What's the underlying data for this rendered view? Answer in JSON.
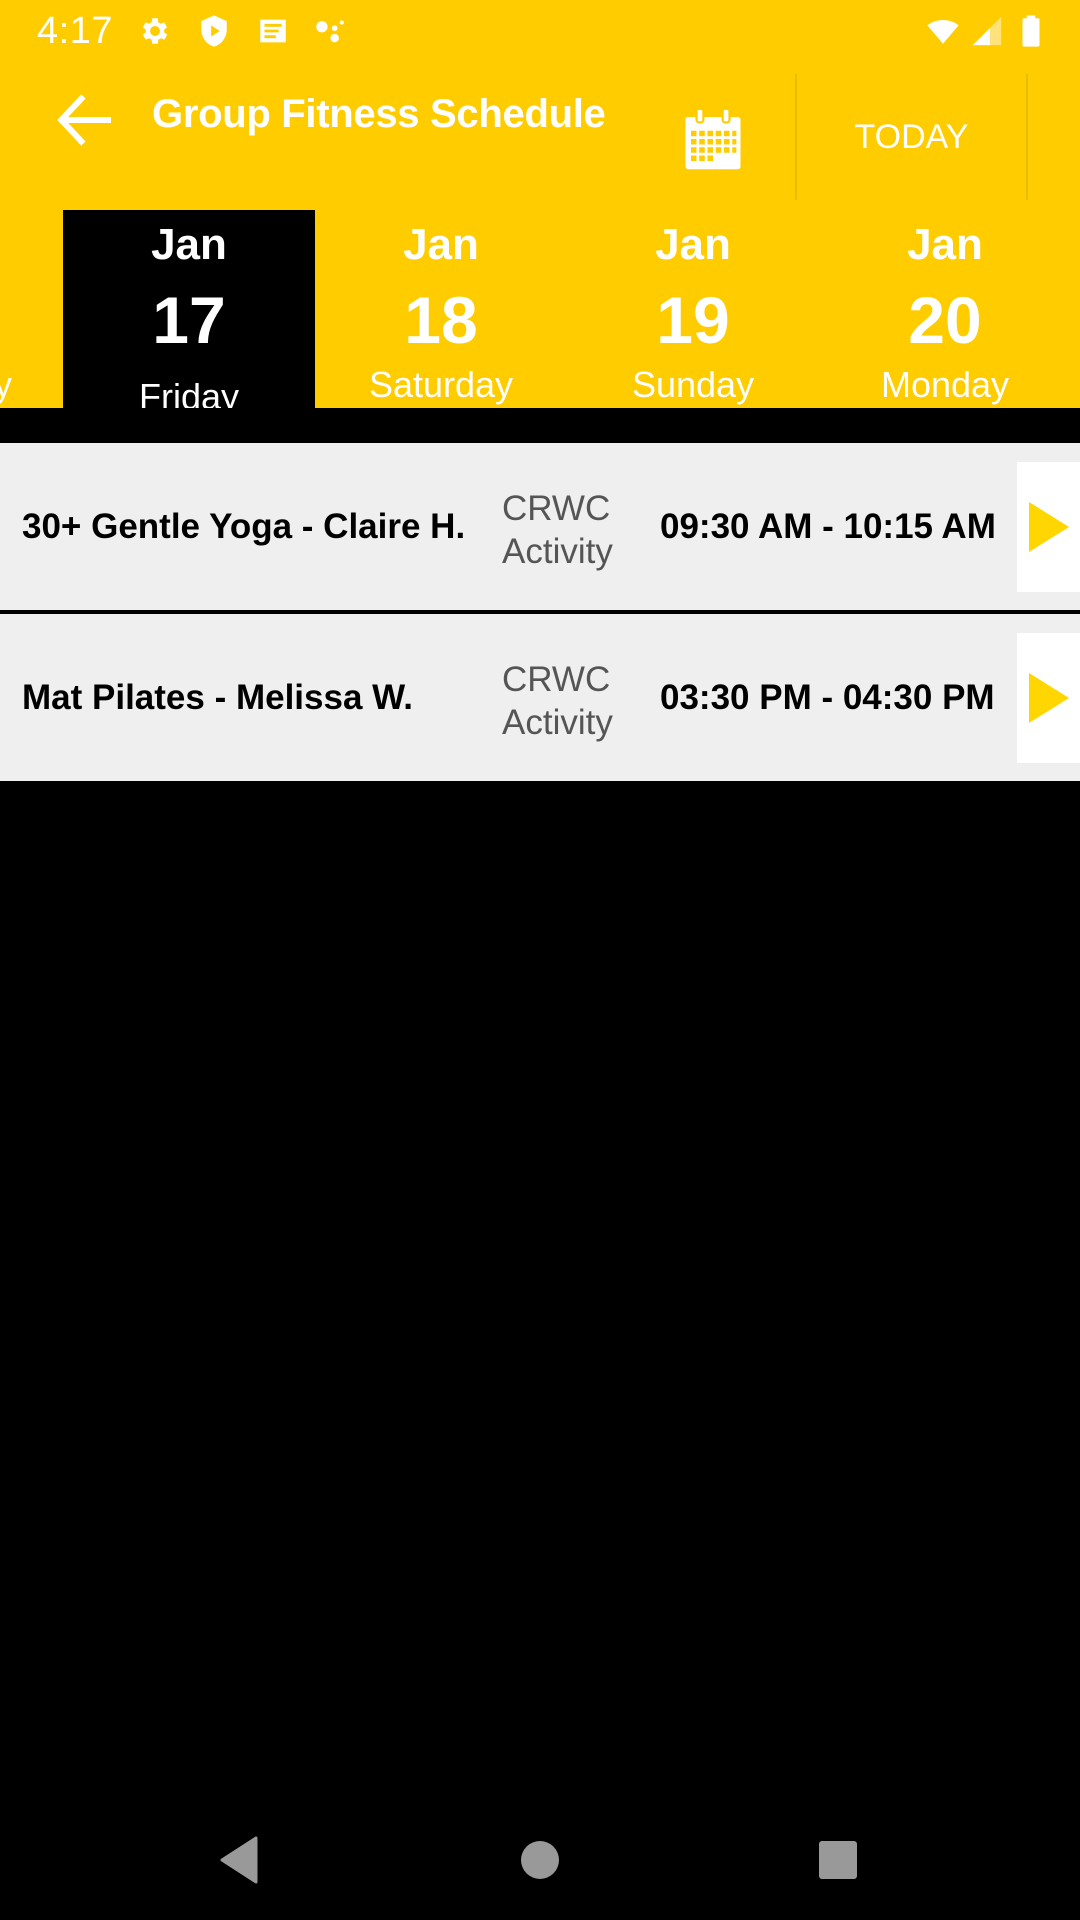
{
  "status_bar": {
    "time": "4:17",
    "left_icons": [
      "settings-icon",
      "shield-play-icon",
      "news-icon",
      "assistant-dots-icon"
    ],
    "right_icons": [
      "wifi-icon",
      "cell-signal-icon",
      "battery-icon"
    ]
  },
  "app_bar": {
    "title": "Group Fitness Schedule",
    "back_icon": "arrow-left-icon",
    "calendar_icon": "calendar-icon",
    "today_label": "TODAY"
  },
  "colors": {
    "brand": "#FFCC00",
    "row_background": "#EFEFEF",
    "arrow": "#FFD600",
    "selected_tab": "#000000"
  },
  "date_tabs": [
    {
      "month": "",
      "day": "",
      "weekday": "y",
      "selected": false,
      "partial": true
    },
    {
      "month": "Jan",
      "day": "17",
      "weekday": "Friday",
      "selected": true
    },
    {
      "month": "Jan",
      "day": "18",
      "weekday": "Saturday",
      "selected": false
    },
    {
      "month": "Jan",
      "day": "19",
      "weekday": "Sunday",
      "selected": false
    },
    {
      "month": "Jan",
      "day": "20",
      "weekday": "Monday",
      "selected": false
    }
  ],
  "classes": [
    {
      "name": "30+ Gentle Yoga - Claire H.",
      "category_line1": "CRWC",
      "category_line2": "Activity",
      "time": "09:30 AM - 10:15 AM",
      "action_icon": "play-arrow-icon"
    },
    {
      "name": "Mat Pilates - Melissa W.",
      "category_line1": "CRWC",
      "category_line2": "Activity",
      "time": "03:30 PM - 04:30 PM",
      "action_icon": "play-arrow-icon"
    }
  ],
  "nav_bar": {
    "buttons": [
      "back-nav-icon",
      "home-nav-icon",
      "recents-nav-icon"
    ]
  }
}
